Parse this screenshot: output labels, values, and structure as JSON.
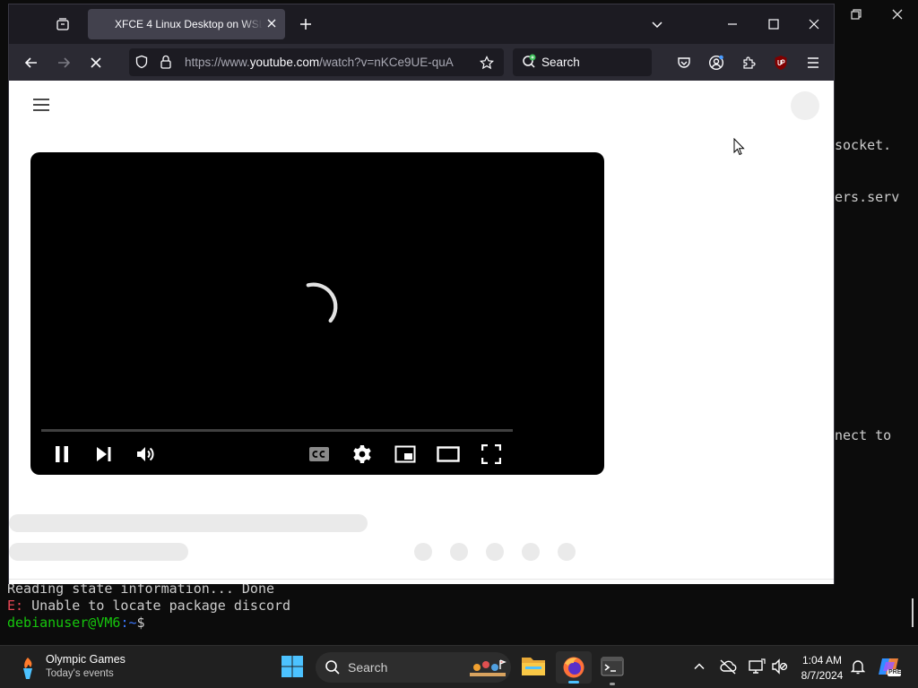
{
  "terminal": {
    "side_lines": [
      "socket.",
      "ers.serv",
      "nect to"
    ],
    "line_reading": "Reading state information... Done",
    "error_prefix": "E:",
    "error_msg": " Unable to locate package discord",
    "prompt_user": "debianuser@VM6",
    "prompt_path": ":~",
    "prompt_symbol": "$"
  },
  "browser": {
    "tab": {
      "title": "XFCE 4 Linux Desktop on WSL (…"
    },
    "url": {
      "prefix": "https://www.",
      "host": "youtube.com",
      "path": "/watch?v=nKCe9UE-quA"
    },
    "search_placeholder": "Search"
  },
  "player": {
    "progress": 0.0,
    "icons": [
      "pause-icon",
      "next-icon",
      "volume-icon",
      "captions-icon",
      "settings-icon",
      "miniplayer-icon",
      "theater-icon",
      "fullscreen-icon"
    ]
  },
  "taskbar": {
    "widget_title": "Olympic Games",
    "widget_subtitle": "Today's events",
    "search_placeholder": "Search",
    "time": "1:04 AM",
    "date": "8/7/2024",
    "colors": {
      "firefox": "#ff7139",
      "windows": "#4cc2ff",
      "folder": "#f9c846"
    }
  }
}
